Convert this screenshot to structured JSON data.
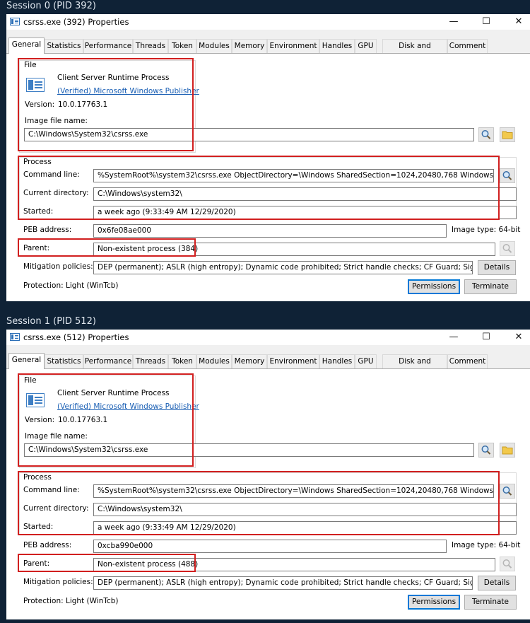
{
  "sessions": [
    {
      "caption": "Session 0 (PID 392)",
      "window_title": "csrss.exe (392) Properties",
      "controls": {
        "minimize": "—",
        "maximize": "☐",
        "close": "✕"
      },
      "tabs": [
        "General",
        "Statistics",
        "Performance",
        "Threads",
        "Token",
        "Modules",
        "Memory",
        "Environment",
        "Handles",
        "GPU",
        "Disk and Network",
        "Comment"
      ],
      "file": {
        "group_label": "File",
        "description": "Client Server Runtime Process",
        "publisher": "(Verified) Microsoft Windows Publisher",
        "version_label": "Version:",
        "version": "10.0.17763.1",
        "image_label": "Image file name:",
        "image_path": "C:\\Windows\\System32\\csrss.exe"
      },
      "process": {
        "group_label": "Process",
        "command_line_label": "Command line:",
        "command_line": "%SystemRoot%\\system32\\csrss.exe ObjectDirectory=\\Windows SharedSection=1024,20480,768 Windows=On SubSystemType=Windows",
        "current_dir_label": "Current directory:",
        "current_dir": "C:\\Windows\\system32\\",
        "started_label": "Started:",
        "started": "a week ago (9:33:49 AM 12/29/2020)"
      },
      "peb_label": "PEB address:",
      "peb": "0x6fe08ae000",
      "image_type": "Image type: 64-bit",
      "parent_label": "Parent:",
      "parent": "Non-existent process (384)",
      "mitigation_label": "Mitigation policies:",
      "mitigation": "DEP (permanent); ASLR (high entropy); Dynamic code prohibited; Strict handle checks; CF Guard; Signatures re",
      "details_button": "Details",
      "protection": "Protection:  Light (WinTcb)",
      "permissions_button": "Permissions",
      "terminate_button": "Terminate"
    },
    {
      "caption": "Session 1 (PID 512)",
      "window_title": "csrss.exe (512) Properties",
      "controls": {
        "minimize": "—",
        "maximize": "☐",
        "close": "✕"
      },
      "tabs": [
        "General",
        "Statistics",
        "Performance",
        "Threads",
        "Token",
        "Modules",
        "Memory",
        "Environment",
        "Handles",
        "GPU",
        "Disk and Network",
        "Comment"
      ],
      "file": {
        "group_label": "File",
        "description": "Client Server Runtime Process",
        "publisher": "(Verified) Microsoft Windows Publisher",
        "version_label": "Version:",
        "version": "10.0.17763.1",
        "image_label": "Image file name:",
        "image_path": "C:\\Windows\\System32\\csrss.exe"
      },
      "process": {
        "group_label": "Process",
        "command_line_label": "Command line:",
        "command_line": "%SystemRoot%\\system32\\csrss.exe ObjectDirectory=\\Windows SharedSection=1024,20480,768 Windows=On SubSystemType=Windows",
        "current_dir_label": "Current directory:",
        "current_dir": "C:\\Windows\\system32\\",
        "started_label": "Started:",
        "started": "a week ago (9:33:49 AM 12/29/2020)"
      },
      "peb_label": "PEB address:",
      "peb": "0xcba990e000",
      "image_type": "Image type: 64-bit",
      "parent_label": "Parent:",
      "parent": "Non-existent process (488)",
      "mitigation_label": "Mitigation policies:",
      "mitigation": "DEP (permanent); ASLR (high entropy); Dynamic code prohibited; Strict handle checks; CF Guard; Signatures re",
      "details_button": "Details",
      "protection": "Protection:  Light (WinTcb)",
      "permissions_button": "Permissions",
      "terminate_button": "Terminate"
    }
  ]
}
